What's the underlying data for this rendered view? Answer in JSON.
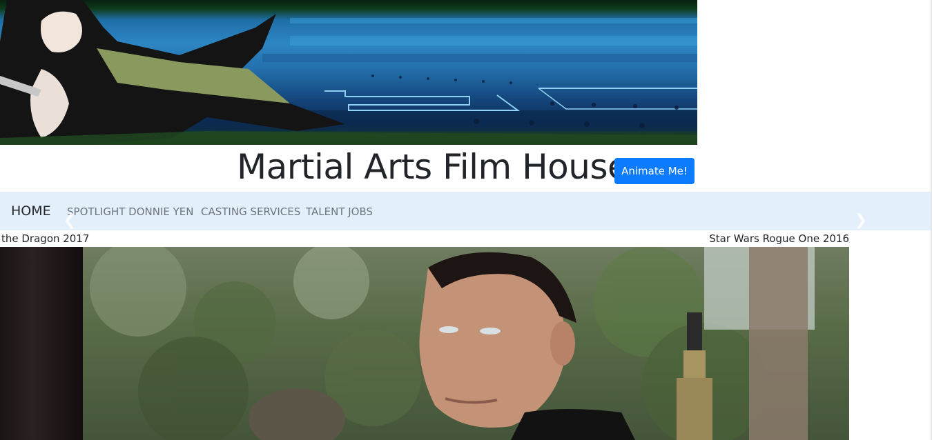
{
  "header": {
    "title": "Martial Arts Film House",
    "animate_button_label": "Animate Me!"
  },
  "navbar": {
    "home_label": "HOME",
    "links": [
      {
        "label": "SPOTLIGHT DONNIE YEN"
      },
      {
        "label": "CASTING SERVICES"
      },
      {
        "label": "TALENT JOBS"
      }
    ],
    "prev_icon": "chevron-left-icon",
    "next_icon": "chevron-right-icon"
  },
  "carousel": {
    "caption_left": "the Dragon 2017",
    "caption_right": "Star Wars Rogue One 2016"
  },
  "colors": {
    "button_primary": "#0d7bfd",
    "navbar_bg": "#e3f0fb",
    "title_text": "#212529",
    "nav_link_text": "#6c757d"
  }
}
